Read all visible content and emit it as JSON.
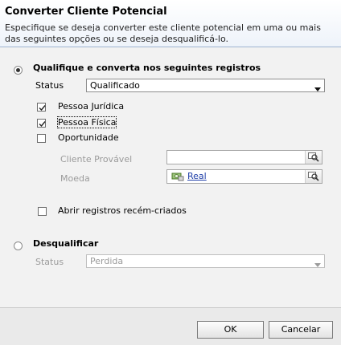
{
  "dialog": {
    "title": "Converter Cliente Potencial",
    "description": "Especifique se deseja converter este cliente potencial em uma ou mais das seguintes opções ou se deseja desqualificá-lo."
  },
  "qualify": {
    "label": "Qualifique e converta nos seguintes registros",
    "selected": true,
    "status_label": "Status",
    "status_value": "Qualificado",
    "options": [
      {
        "label": "Pessoa Jurídica",
        "checked": true
      },
      {
        "label": "Pessoa Física",
        "checked": true
      },
      {
        "label": "Oportunidade",
        "checked": false
      }
    ],
    "potential_customer_label": "Cliente Provável",
    "potential_customer_value": "",
    "currency_label": "Moeda",
    "currency_value": "Real",
    "open_new_label": "Abrir registros recém-criados",
    "open_new_checked": false
  },
  "disqualify": {
    "label": "Desqualificar",
    "selected": false,
    "status_label": "Status",
    "status_value": "Perdida"
  },
  "buttons": {
    "ok": "OK",
    "cancel": "Cancelar"
  },
  "icons": {
    "lookup": "magnifier-lookup-icon",
    "currency": "currency-record-icon",
    "dropdown": "chevron-down-icon",
    "check": "checkmark-icon"
  }
}
